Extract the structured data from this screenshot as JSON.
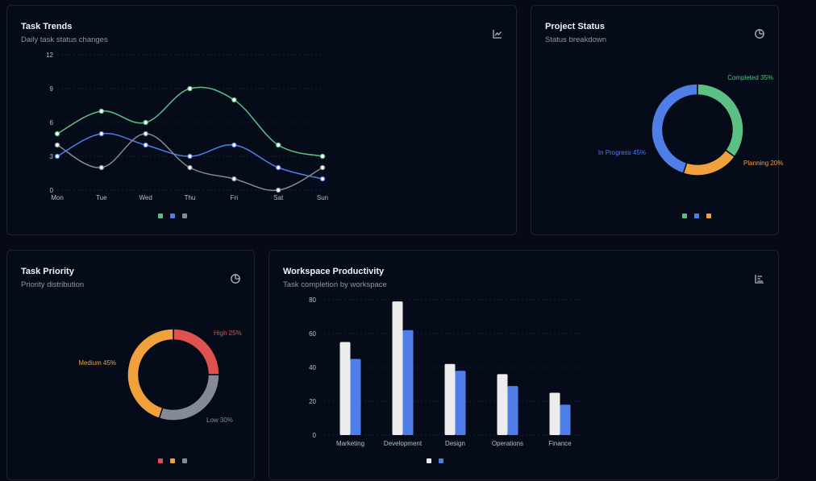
{
  "colors": {
    "green": "#5cbf84",
    "blue": "#4f7ee8",
    "gray": "#858b95",
    "orange": "#f1a13b",
    "red": "#e0524f",
    "white": "#ececec"
  },
  "cards": {
    "trends": {
      "title": "Task Trends",
      "subtitle": "Daily task status changes",
      "icon": "line-chart-icon"
    },
    "status": {
      "title": "Project Status",
      "subtitle": "Status breakdown",
      "icon": "pie-chart-icon"
    },
    "priority": {
      "title": "Task Priority",
      "subtitle": "Priority distribution",
      "icon": "pie-chart-icon"
    },
    "productivity": {
      "title": "Workspace Productivity",
      "subtitle": "Task completion by workspace",
      "icon": "bar-chart-icon"
    }
  },
  "chart_data": [
    {
      "id": "trends",
      "type": "line",
      "categories": [
        "Mon",
        "Tue",
        "Wed",
        "Thu",
        "Fri",
        "Sat",
        "Sun"
      ],
      "ylim": [
        0,
        12
      ],
      "yticks": [
        0,
        3,
        6,
        9,
        12
      ],
      "series": [
        {
          "color": "#5cbf84",
          "values": [
            5,
            7,
            6,
            9,
            8,
            4,
            3
          ]
        },
        {
          "color": "#4f7ee8",
          "values": [
            3,
            5,
            4,
            3,
            4,
            2,
            1
          ]
        },
        {
          "color": "#858b95",
          "values": [
            4,
            2,
            5,
            2,
            1,
            0,
            2
          ]
        }
      ],
      "legend": "bottom-center",
      "smooth": true
    },
    {
      "id": "status",
      "type": "pie",
      "donut": true,
      "slices": [
        {
          "label": "Completed 35%",
          "value": 35,
          "color": "#5cbf84"
        },
        {
          "label": "Planning 20%",
          "value": 20,
          "color": "#f1a13b"
        },
        {
          "label": "In Progress 45%",
          "value": 45,
          "color": "#4f7ee8"
        }
      ],
      "legend_order": [
        "#5cbf84",
        "#4f7ee8",
        "#f1a13b"
      ],
      "legend": "bottom-center"
    },
    {
      "id": "priority",
      "type": "pie",
      "donut": true,
      "slices": [
        {
          "label": "High 25%",
          "value": 25,
          "color": "#e0524f"
        },
        {
          "label": "Low 30%",
          "value": 30,
          "color": "#858b95"
        },
        {
          "label": "Medium 45%",
          "value": 45,
          "color": "#f1a13b"
        }
      ],
      "legend_order": [
        "#e0524f",
        "#f1a13b",
        "#858b95"
      ],
      "legend": "bottom-center"
    },
    {
      "id": "productivity",
      "type": "bar",
      "categories": [
        "Marketing",
        "Development",
        "Design",
        "Operations",
        "Finance"
      ],
      "ylim": [
        0,
        80
      ],
      "yticks": [
        0,
        20,
        40,
        60,
        80
      ],
      "series": [
        {
          "color": "#ececec",
          "values": [
            55,
            79,
            42,
            36,
            25
          ]
        },
        {
          "color": "#4f7ee8",
          "values": [
            45,
            62,
            38,
            29,
            18
          ]
        }
      ],
      "legend": "bottom-center"
    }
  ]
}
